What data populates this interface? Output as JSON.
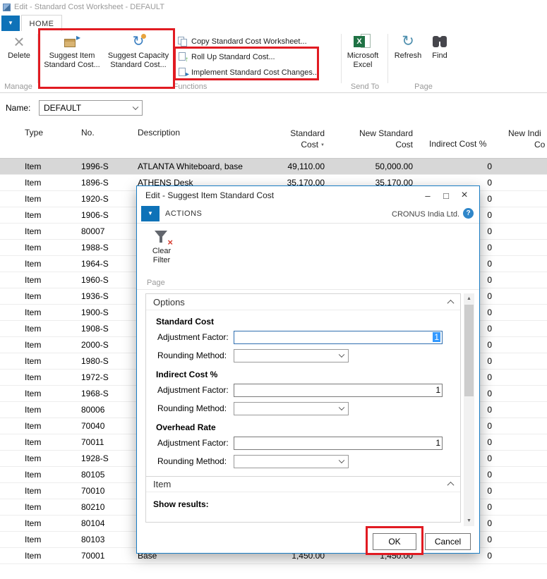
{
  "colors": {
    "accent_blue": "#0e72b8",
    "annotation_red": "#e11b22",
    "selected_row": "#d7d7d7",
    "excel_green": "#1f7244"
  },
  "window": {
    "title": "Edit - Standard Cost Worksheet - DEFAULT",
    "home_tab": "HOME"
  },
  "ribbon": {
    "delete": "Delete",
    "suggest_item": "Suggest Item Standard Cost...",
    "suggest_capacity": "Suggest Capacity Standard Cost...",
    "copy_worksheet": "Copy Standard Cost Worksheet...",
    "roll_up": "Roll Up Standard Cost...",
    "implement": "Implement Standard Cost Changes...",
    "excel": "Microsoft Excel",
    "refresh": "Refresh",
    "find": "Find",
    "group_manage": "Manage",
    "group_functions": "Functions",
    "group_sendto": "Send To",
    "group_page": "Page"
  },
  "name_field": {
    "label": "Name:",
    "value": "DEFAULT"
  },
  "table": {
    "columns": {
      "type": "Type",
      "no": "No.",
      "description": "Description",
      "standard_cost": [
        "Standard",
        "Cost"
      ],
      "new_standard_cost": [
        "New Standard",
        "Cost"
      ],
      "indirect_cost_pct": "Indirect Cost %",
      "new_indirect_cost_pct": [
        "New Indi",
        "Co"
      ]
    },
    "rows": [
      {
        "type": "Item",
        "no": "1996-S",
        "description": "ATLANTA Whiteboard, base",
        "standard_cost": "49,110.00",
        "new_standard_cost": "50,000.00",
        "indirect_cost_pct": "0",
        "selected": true
      },
      {
        "type": "Item",
        "no": "1896-S",
        "description": "ATHENS Desk",
        "standard_cost": "35,170.00",
        "new_standard_cost": "35,170.00",
        "indirect_cost_pct": "0"
      },
      {
        "type": "Item",
        "no": "1920-S",
        "description": "",
        "standard_cost": "",
        "new_standard_cost": "",
        "indirect_cost_pct": "0"
      },
      {
        "type": "Item",
        "no": "1906-S",
        "description": "",
        "standard_cost": "",
        "new_standard_cost": "",
        "indirect_cost_pct": "0"
      },
      {
        "type": "Item",
        "no": "80007",
        "description": "",
        "standard_cost": "",
        "new_standard_cost": "",
        "indirect_cost_pct": "0"
      },
      {
        "type": "Item",
        "no": "1988-S",
        "description": "",
        "standard_cost": "",
        "new_standard_cost": "",
        "indirect_cost_pct": "0"
      },
      {
        "type": "Item",
        "no": "1964-S",
        "description": "",
        "standard_cost": "",
        "new_standard_cost": "",
        "indirect_cost_pct": "0"
      },
      {
        "type": "Item",
        "no": "1960-S",
        "description": "",
        "standard_cost": "",
        "new_standard_cost": "",
        "indirect_cost_pct": "0"
      },
      {
        "type": "Item",
        "no": "1936-S",
        "description": "",
        "standard_cost": "",
        "new_standard_cost": "",
        "indirect_cost_pct": "0"
      },
      {
        "type": "Item",
        "no": "1900-S",
        "description": "",
        "standard_cost": "",
        "new_standard_cost": "",
        "indirect_cost_pct": "0"
      },
      {
        "type": "Item",
        "no": "1908-S",
        "description": "",
        "standard_cost": "",
        "new_standard_cost": "",
        "indirect_cost_pct": "0"
      },
      {
        "type": "Item",
        "no": "2000-S",
        "description": "",
        "standard_cost": "",
        "new_standard_cost": "",
        "indirect_cost_pct": "0"
      },
      {
        "type": "Item",
        "no": "1980-S",
        "description": "",
        "standard_cost": "",
        "new_standard_cost": "",
        "indirect_cost_pct": "0"
      },
      {
        "type": "Item",
        "no": "1972-S",
        "description": "",
        "standard_cost": "",
        "new_standard_cost": "",
        "indirect_cost_pct": "0"
      },
      {
        "type": "Item",
        "no": "1968-S",
        "description": "",
        "standard_cost": "",
        "new_standard_cost": "",
        "indirect_cost_pct": "0"
      },
      {
        "type": "Item",
        "no": "80006",
        "description": "",
        "standard_cost": "",
        "new_standard_cost": "",
        "indirect_cost_pct": "0"
      },
      {
        "type": "Item",
        "no": "70040",
        "description": "",
        "standard_cost": "",
        "new_standard_cost": "",
        "indirect_cost_pct": "0"
      },
      {
        "type": "Item",
        "no": "70011",
        "description": "",
        "standard_cost": "",
        "new_standard_cost": "",
        "indirect_cost_pct": "0"
      },
      {
        "type": "Item",
        "no": "1928-S",
        "description": "",
        "standard_cost": "",
        "new_standard_cost": "",
        "indirect_cost_pct": "0"
      },
      {
        "type": "Item",
        "no": "80105",
        "description": "",
        "standard_cost": "",
        "new_standard_cost": "",
        "indirect_cost_pct": "0"
      },
      {
        "type": "Item",
        "no": "70010",
        "description": "",
        "standard_cost": "",
        "new_standard_cost": "",
        "indirect_cost_pct": "0"
      },
      {
        "type": "Item",
        "no": "80210",
        "description": "",
        "standard_cost": "",
        "new_standard_cost": "",
        "indirect_cost_pct": "0"
      },
      {
        "type": "Item",
        "no": "80104",
        "description": "",
        "standard_cost": "",
        "new_standard_cost": "",
        "indirect_cost_pct": "0"
      },
      {
        "type": "Item",
        "no": "80103",
        "description": "",
        "standard_cost": "",
        "new_standard_cost": "",
        "indirect_cost_pct": "0"
      },
      {
        "type": "Item",
        "no": "70001",
        "description": "Base",
        "standard_cost": "1,450.00",
        "new_standard_cost": "1,450.00",
        "indirect_cost_pct": "0"
      }
    ]
  },
  "dialog": {
    "title": "Edit - Suggest Item Standard Cost",
    "actions_tab": "ACTIONS",
    "company": "CRONUS India Ltd.",
    "clear_filter": "Clear Filter",
    "group_page": "Page",
    "options": {
      "title": "Options",
      "sections": [
        {
          "heading": "Standard Cost",
          "adjustment_label": "Adjustment Factor:",
          "adjustment_value": "1",
          "rounding_label": "Rounding Method:",
          "rounding_value": "",
          "focused": true
        },
        {
          "heading": "Indirect Cost %",
          "adjustment_label": "Adjustment Factor:",
          "adjustment_value": "1",
          "rounding_label": "Rounding Method:",
          "rounding_value": ""
        },
        {
          "heading": "Overhead Rate",
          "adjustment_label": "Adjustment Factor:",
          "adjustment_value": "1",
          "rounding_label": "Rounding Method:",
          "rounding_value": ""
        }
      ]
    },
    "item_section": {
      "title": "Item",
      "show_results_label": "Show results:"
    },
    "ok_button": "OK",
    "cancel_button": "Cancel"
  },
  "annotations": {
    "color": "#e11b22"
  }
}
